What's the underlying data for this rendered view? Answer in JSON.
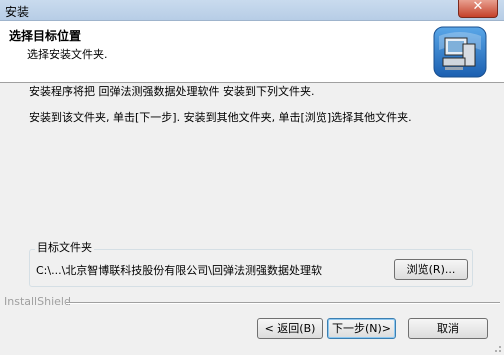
{
  "window": {
    "title": "安装"
  },
  "header": {
    "title": "选择目标位置",
    "subtitle": "选择安装文件夹."
  },
  "body": {
    "line1": "安装程序将把 回弹法测强数据处理软件 安装到下列文件夹.",
    "line2": "安装到该文件夹, 单击[下一步]. 安装到其他文件夹, 单击[浏览]选择其他文件夹."
  },
  "destination": {
    "group_label": "目标文件夹",
    "path": "C:\\...\\北京智博联科技股份有限公司\\回弹法测强数据处理软",
    "browse_label": "浏览(R)..."
  },
  "footer": {
    "brand": "InstallShield",
    "back_label": "< 返回(B)",
    "next_label": "下一步(N)>",
    "cancel_label": "取消"
  },
  "icons": {
    "close": "close-icon",
    "logo": "installer-computer-icon",
    "grip": "resize-grip-icon"
  }
}
